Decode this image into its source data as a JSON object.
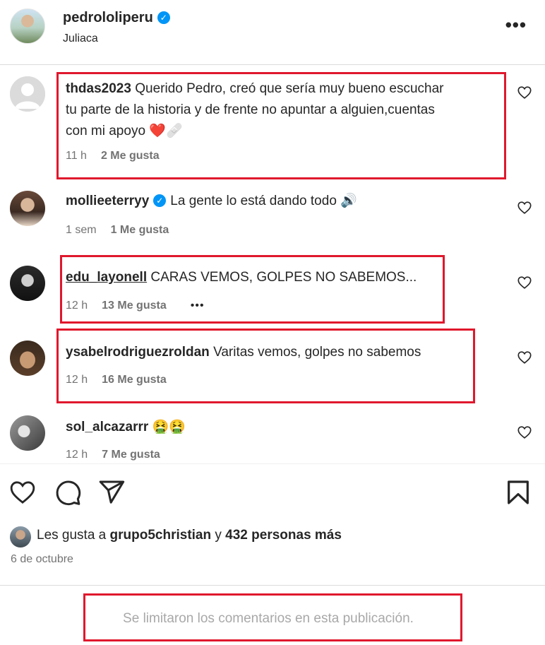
{
  "post": {
    "username": "pedrololiperu",
    "location": "Juliaca"
  },
  "comments": [
    {
      "username": "thdas2023",
      "text": "Querido Pedro, creó que sería muy bueno escuchar",
      "text2": "tu parte de la historia y de frente no apuntar a alguien,cuentas",
      "text3": "con mi apoyo ❤️🩹",
      "time": "11 h",
      "likes": "2 Me gusta"
    },
    {
      "username": "mollieeterryy",
      "text": "La gente lo está dando todo 🔊",
      "time": "1 sem",
      "likes": "1 Me gusta"
    },
    {
      "username": "edu_layonell",
      "text": "CARAS VEMOS, GOLPES NO SABEMOS...",
      "time": "12 h",
      "likes": "13 Me gusta",
      "more": "•••"
    },
    {
      "username": "ysabelrodriguezroldan",
      "text": "Varitas vemos, golpes no sabemos",
      "time": "12 h",
      "likes": "16 Me gusta"
    },
    {
      "username": "sol_alcazarrr",
      "text": "🤮🤮",
      "time": "12 h",
      "likes": "7 Me gusta"
    }
  ],
  "likes_line": {
    "prefix": "Les gusta a ",
    "user": "grupo5christian",
    "middle": " y ",
    "count": "432 personas más"
  },
  "date": "6 de octubre",
  "footer_text": "Se limitaron los comentarios en esta publicación.",
  "colors": {
    "highlight": "#e0182d",
    "verified": "#0095f6"
  }
}
